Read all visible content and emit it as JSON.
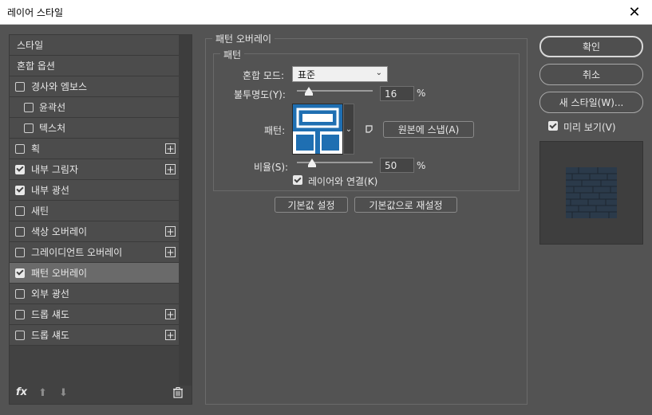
{
  "window": {
    "title": "레이어 스타일",
    "close_glyph": "✕"
  },
  "left_panel": {
    "items": [
      {
        "label": "스타일",
        "header": true
      },
      {
        "label": "혼합 옵션",
        "header": true
      },
      {
        "label": "경사와 엠보스",
        "checkbox": true,
        "checked": false
      },
      {
        "label": "윤곽선",
        "checkbox": true,
        "checked": false,
        "indent": true
      },
      {
        "label": "텍스처",
        "checkbox": true,
        "checked": false,
        "indent": true
      },
      {
        "label": "획",
        "checkbox": true,
        "checked": false,
        "plus": true
      },
      {
        "label": "내부 그림자",
        "checkbox": true,
        "checked": true,
        "plus": true
      },
      {
        "label": "내부 광선",
        "checkbox": true,
        "checked": true
      },
      {
        "label": "새틴",
        "checkbox": true,
        "checked": false
      },
      {
        "label": "색상 오버레이",
        "checkbox": true,
        "checked": false,
        "plus": true
      },
      {
        "label": "그레이디언트 오버레이",
        "checkbox": true,
        "checked": false,
        "plus": true
      },
      {
        "label": "패턴 오버레이",
        "checkbox": true,
        "checked": true,
        "selected": true
      },
      {
        "label": "외부 광선",
        "checkbox": true,
        "checked": false
      },
      {
        "label": "드롭 섀도",
        "checkbox": true,
        "checked": false,
        "plus": true
      },
      {
        "label": "드롭 섀도",
        "checkbox": true,
        "checked": false,
        "plus": true
      }
    ],
    "footer": {
      "fx_label": "fx",
      "up_glyph": "⬆",
      "down_glyph": "⬇"
    }
  },
  "pattern_overlay": {
    "group_title": "패턴 오버레이",
    "subgroup_title": "패턴",
    "blend_mode_label": "혼합 모드:",
    "blend_mode_value": "표준",
    "opacity_label": "불투명도(Y):",
    "opacity_value": "16",
    "opacity_fraction": 0.16,
    "percent_sign": "%",
    "pattern_label": "패턴:",
    "snap_origin_label": "원본에 스냅(A)",
    "scale_label": "비율(S):",
    "scale_value": "50",
    "scale_fraction": 0.2,
    "link_layer_label": "레이어와 연결(K)",
    "make_default_label": "기본값 설정",
    "reset_default_label": "기본값으로 재설정"
  },
  "right_panel": {
    "ok_label": "확인",
    "cancel_label": "취소",
    "new_style_label": "새 스타일(W)...",
    "preview_label": "미리 보기(V)"
  },
  "colors": {
    "panel_bg": "#535353",
    "pattern_blue": "#1f6fb2",
    "preview_tile": "#2b3a4a"
  }
}
